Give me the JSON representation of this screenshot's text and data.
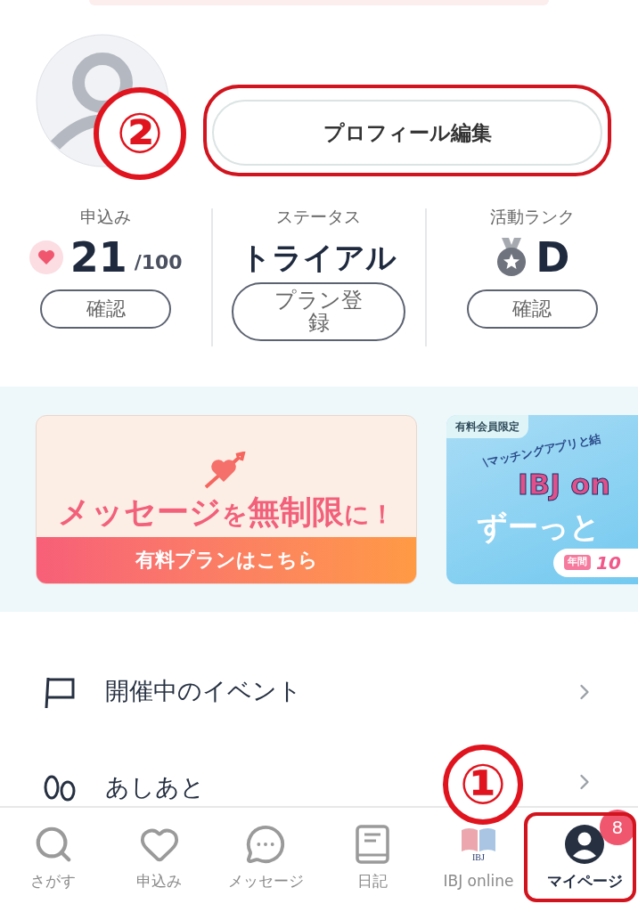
{
  "profile": {
    "edit_button": "プロフィール編集"
  },
  "stats": [
    {
      "label": "申込み",
      "value": "21",
      "suffix": "/100",
      "button": "確認"
    },
    {
      "label": "ステータス",
      "value": "トライアル",
      "button": "プラン登録"
    },
    {
      "label": "活動ランク",
      "value": "D",
      "button": "確認"
    }
  ],
  "banners": [
    {
      "kind": "message",
      "headline_parts": [
        "メッセージ",
        "を",
        "無制限",
        "に！"
      ],
      "cta": "有料プランはこちら"
    },
    {
      "kind": "online",
      "tag": "有料会員限定",
      "lines": [
        "\\マッチングアプリと結",
        "IBJ on",
        "ずーっと"
      ],
      "pill_tag": "年間",
      "pill_text": "10"
    }
  ],
  "menu": [
    {
      "label": "開催中のイベント"
    },
    {
      "label": "あしあと"
    }
  ],
  "tabs": [
    {
      "label": "さがす",
      "selected": false
    },
    {
      "label": "申込み",
      "selected": false
    },
    {
      "label": "メッセージ",
      "selected": false
    },
    {
      "label": "日記",
      "selected": false
    },
    {
      "label": "IBJ online",
      "selected": false,
      "logo_text": "IBJ"
    },
    {
      "label": "マイページ",
      "selected": true,
      "badge": "8"
    }
  ],
  "annotations": [
    {
      "label": "②"
    },
    {
      "label": "①"
    }
  ]
}
